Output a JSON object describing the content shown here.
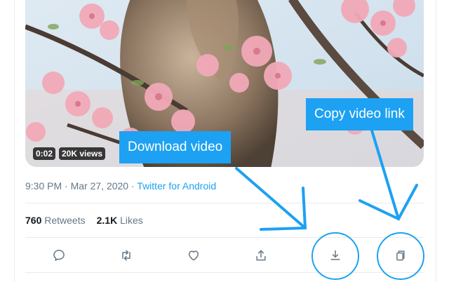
{
  "tweet": {
    "video": {
      "duration": "0:02",
      "views": "20K views"
    },
    "meta": {
      "time": "9:30 PM",
      "separator1": " · ",
      "date": "Mar 27, 2020",
      "separator2": " · ",
      "source": "Twitter for Android"
    },
    "stats": {
      "retweets_count": "760",
      "retweets_label": "Retweets",
      "likes_count": "2.1K",
      "likes_label": "Likes"
    },
    "actions": [
      {
        "name": "reply",
        "icon": "reply-icon"
      },
      {
        "name": "retweet",
        "icon": "retweet-icon"
      },
      {
        "name": "like",
        "icon": "heart-icon"
      },
      {
        "name": "share",
        "icon": "share-icon"
      },
      {
        "name": "download",
        "icon": "download-icon"
      },
      {
        "name": "copy-link",
        "icon": "copy-icon"
      }
    ]
  },
  "annotations": {
    "download_label": "Download video",
    "copy_label": "Copy video link",
    "accent_color": "#1da1f2"
  }
}
